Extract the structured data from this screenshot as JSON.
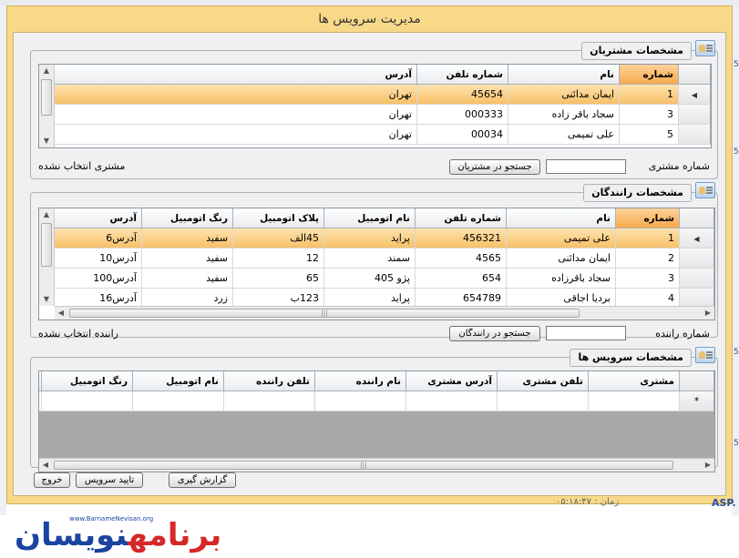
{
  "window": {
    "title": "مدیریت سرویس ها"
  },
  "customers": {
    "title": "مشخصات مشتریان",
    "columns": [
      "شماره",
      "نام",
      "شماره تلفن",
      "آدرس"
    ],
    "rows": [
      {
        "id": "1",
        "name": "ایمان مدائنی",
        "phone": "45654",
        "address": "تهران"
      },
      {
        "id": "3",
        "name": "سجاد باقر زاده",
        "phone": "000333",
        "address": "تهران"
      },
      {
        "id": "5",
        "name": "علی تمیمی",
        "phone": "00034",
        "address": "تهران"
      }
    ],
    "number_label": "شماره مشتری",
    "search_button": "جستجو در مشتریان",
    "status": "مشتری انتخاب نشده"
  },
  "drivers": {
    "title": "مشخصات رانندگان",
    "columns": [
      "شماره",
      "نام",
      "شماره تلفن",
      "نام اتومبیل",
      "پلاک اتومبیل",
      "رنگ اتومبیل",
      "آدرس"
    ],
    "rows": [
      {
        "id": "1",
        "name": "علی تمیمی",
        "phone": "456321",
        "car": "پراید",
        "plate": "45الف",
        "color": "سفید",
        "address": "آدرس6"
      },
      {
        "id": "2",
        "name": "ایمان مدائنی",
        "phone": "4565",
        "car": "سمند",
        "plate": "12",
        "color": "سفید",
        "address": "آدرس10"
      },
      {
        "id": "3",
        "name": "سجاد باقرزاده",
        "phone": "654",
        "car": "پژو 405",
        "plate": "65",
        "color": "سفید",
        "address": "آدرس100"
      },
      {
        "id": "4",
        "name": "بردیا اجاقی",
        "phone": "654789",
        "car": "پراید",
        "plate": "123ب",
        "color": "زرد",
        "address": "آدرس16"
      }
    ],
    "number_label": "شماره راننده",
    "search_button": "جستجو در رانندگان",
    "status": "راننده انتخاب نشده"
  },
  "services": {
    "title": "مشخصات سرویس ها",
    "columns": [
      "مشتری",
      "تلفن مشتری",
      "آدرس مشتری",
      "نام راننده",
      "تلفن راننده",
      "نام اتومبیل",
      "رنگ اتومبیل"
    ],
    "new_row_marker": "*"
  },
  "buttons": {
    "report": "گزارش گیری",
    "confirm": "تایید سرویس",
    "exit": "خروج"
  },
  "background": {
    "clock": "زمان : ۰۵:۱۸:۴۷",
    "asp": "ASP.",
    "logo_url": "www.BarnameNevisan.org",
    "logo_text_red": "برنامه",
    "logo_text_blue": "نویسان"
  },
  "colors": {
    "dialog_border": "#f8d98a",
    "selected_row": "#f8c068",
    "sorted_header": "#f7a94b"
  }
}
